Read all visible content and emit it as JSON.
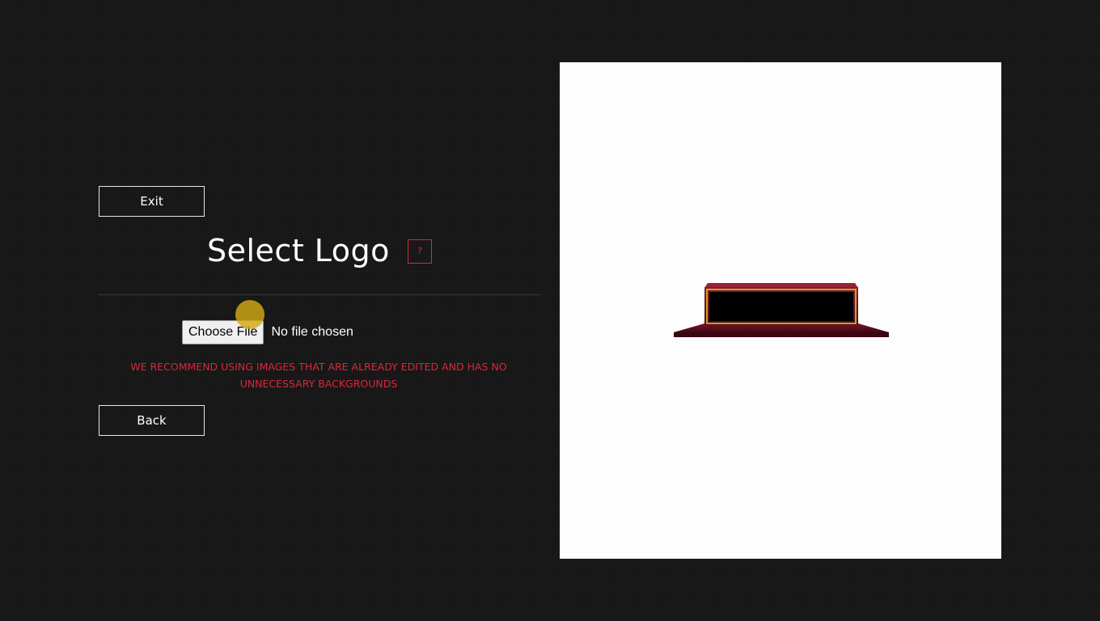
{
  "left_panel": {
    "exit_label": "Exit",
    "title": "Select Logo",
    "help_label": "?",
    "file_input": {
      "button_label": "Choose File",
      "status": "No file chosen"
    },
    "warning": "WE RECOMMEND USING IMAGES THAT ARE ALREADY EDITED AND HAS NO UNNECESSARY BACKGROUNDS",
    "back_label": "Back"
  },
  "preview": {
    "object": "trophy-plaque-base",
    "colors": {
      "base": "#5a0c1c",
      "plate": "#000000",
      "trim": "#c9a227"
    }
  },
  "colors": {
    "background": "#151515",
    "accent": "#d8283c",
    "canvas": "#fdfdfd",
    "cursor_highlight": "#d2aa14"
  }
}
